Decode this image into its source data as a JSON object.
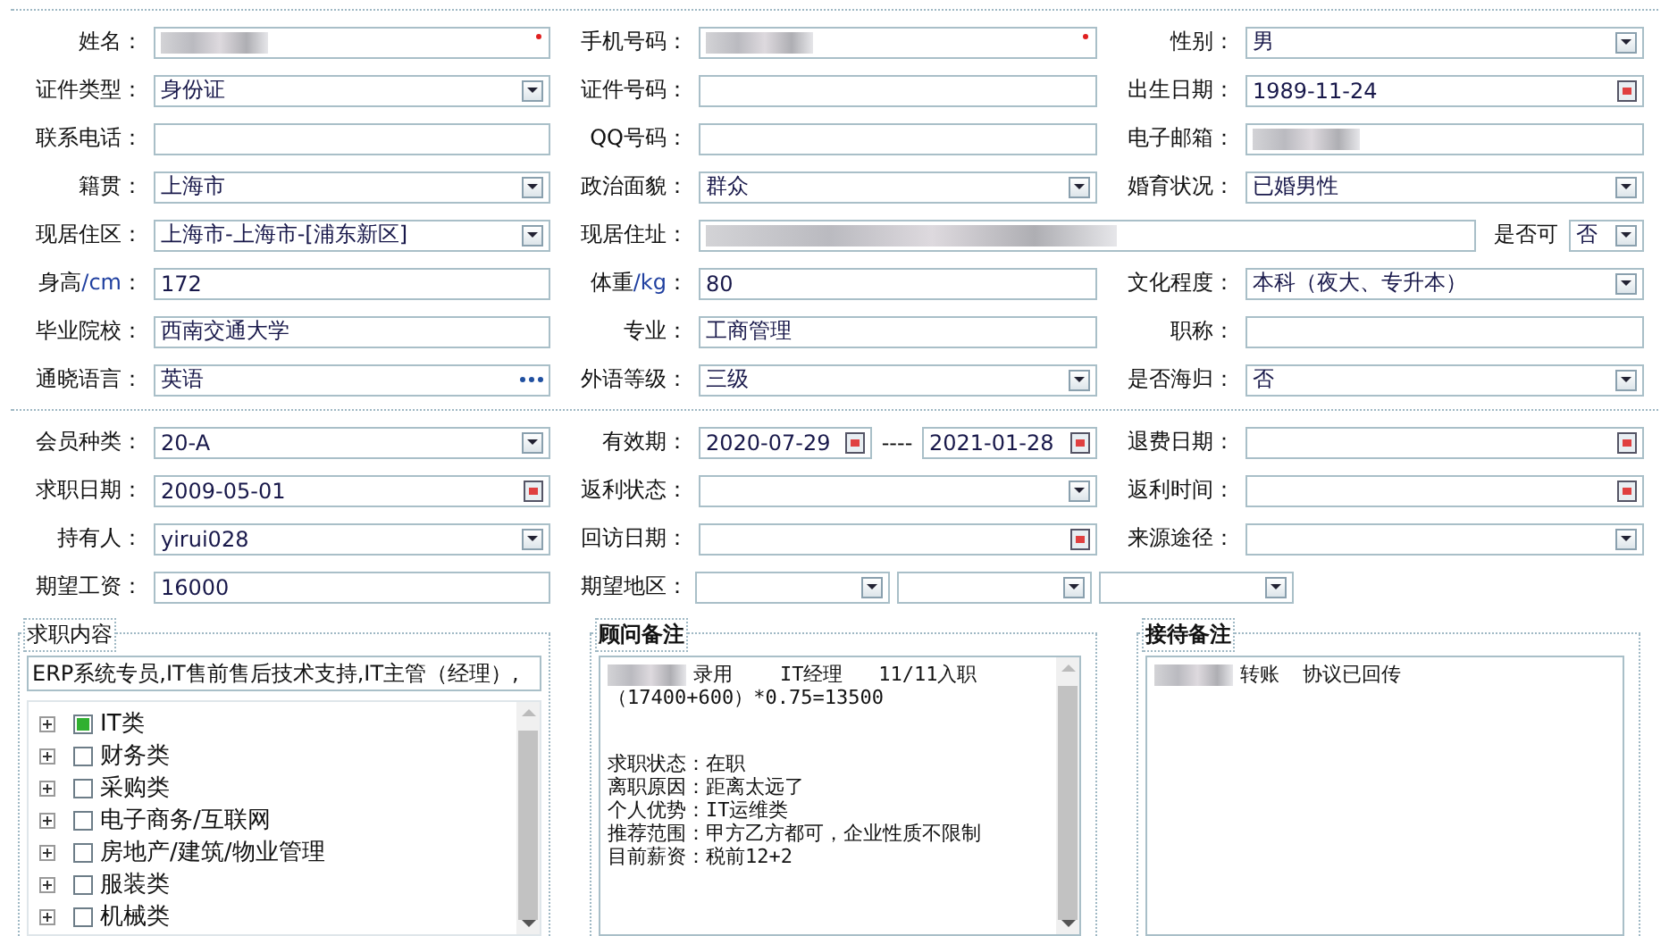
{
  "profile_rows": [
    [
      {
        "label": "姓名：",
        "field": {
          "kind": "text",
          "redacted": true,
          "required": true
        }
      },
      {
        "label": "手机号码：",
        "field": {
          "kind": "text",
          "redacted": true,
          "required": true
        }
      },
      {
        "label": "性别：",
        "field": {
          "kind": "select",
          "value": "男"
        }
      }
    ],
    [
      {
        "label": "证件类型：",
        "field": {
          "kind": "select",
          "value": "身份证"
        }
      },
      {
        "label": "证件号码：",
        "field": {
          "kind": "text"
        }
      },
      {
        "label": "出生日期：",
        "field": {
          "kind": "date",
          "value": "1989-11-24"
        }
      }
    ],
    [
      {
        "label": "联系电话：",
        "field": {
          "kind": "text"
        }
      },
      {
        "label": "QQ号码：",
        "field": {
          "kind": "text"
        }
      },
      {
        "label": "电子邮箱：",
        "field": {
          "kind": "text",
          "redacted": true
        }
      }
    ],
    [
      {
        "label": "籍贯：",
        "field": {
          "kind": "select",
          "value": "上海市"
        }
      },
      {
        "label": "政治面貌：",
        "field": {
          "kind": "select",
          "value": "群众"
        }
      },
      {
        "label": "婚育状况：",
        "field": {
          "kind": "select",
          "value": "已婚男性"
        }
      }
    ],
    [
      {
        "label": "现居住区：",
        "field": {
          "kind": "select",
          "value": "上海市-上海市-[浦东新区]"
        }
      },
      {
        "label": "现居住址：",
        "field": {
          "kind": "address",
          "redacted": true,
          "option_label": "是否可",
          "option_value": "否"
        }
      }
    ],
    [
      {
        "label": "身高",
        "unit": "/cm",
        "colon": "：",
        "field": {
          "kind": "text",
          "value": "172"
        }
      },
      {
        "label": "体重",
        "unit": "/kg",
        "colon": "：",
        "field": {
          "kind": "text",
          "value": "80"
        }
      },
      {
        "label": "文化程度：",
        "field": {
          "kind": "select",
          "value": "本科（夜大、专升本）"
        }
      }
    ],
    [
      {
        "label": "毕业院校：",
        "field": {
          "kind": "text",
          "value": "西南交通大学"
        }
      },
      {
        "label": "专业：",
        "field": {
          "kind": "text",
          "value": "工商管理"
        }
      },
      {
        "label": "职称：",
        "field": {
          "kind": "text"
        }
      }
    ],
    [
      {
        "label": "通晓语言：",
        "field": {
          "kind": "picker",
          "value": "英语"
        }
      },
      {
        "label": "外语等级：",
        "field": {
          "kind": "select",
          "value": "三级"
        }
      },
      {
        "label": "是否海归：",
        "field": {
          "kind": "select",
          "value": "否"
        }
      }
    ]
  ],
  "membership_rows": [
    [
      {
        "label": "会员种类：",
        "field": {
          "kind": "select",
          "value": "20-A"
        }
      },
      {
        "label": "有效期：",
        "field": {
          "kind": "date_range",
          "from": "2020-07-29",
          "separator": "----",
          "to": "2021-01-28"
        }
      },
      {
        "label": "退费日期：",
        "field": {
          "kind": "date"
        }
      }
    ],
    [
      {
        "label": "求职日期：",
        "field": {
          "kind": "date",
          "value": "2009-05-01"
        }
      },
      {
        "label": "返利状态：",
        "field": {
          "kind": "select"
        }
      },
      {
        "label": "返利时间：",
        "field": {
          "kind": "date"
        }
      }
    ],
    [
      {
        "label": "持有人：",
        "field": {
          "kind": "select",
          "value": "yirui028"
        }
      },
      {
        "label": "回访日期：",
        "field": {
          "kind": "date"
        }
      },
      {
        "label": "来源途径：",
        "field": {
          "kind": "select"
        }
      }
    ],
    [
      {
        "label": "期望工资：",
        "field": {
          "kind": "text",
          "value": "16000"
        }
      },
      {
        "label": "期望地区：",
        "field": {
          "kind": "multi_select",
          "selects": [
            {
              "kind": "select"
            },
            {
              "kind": "select"
            },
            {
              "kind": "select"
            }
          ]
        }
      }
    ]
  ],
  "job_panel": {
    "legend": "求职内容",
    "summary": "ERP系统专员,IT售前售后技术支持,IT主管（经理）,",
    "categories": [
      {
        "label": "IT类",
        "checked": true
      },
      {
        "label": "财务类",
        "checked": false
      },
      {
        "label": "采购类",
        "checked": false
      },
      {
        "label": "电子商务/互联网",
        "checked": false
      },
      {
        "label": "房地产/建筑/物业管理",
        "checked": false
      },
      {
        "label": "服装类",
        "checked": false
      },
      {
        "label": "机械类",
        "checked": false
      }
    ]
  },
  "advisor_panel": {
    "legend": "顾问备注",
    "paragraphs": [
      [
        {
          "text": "录用    IT经理   11/11入职",
          "redacted": true
        },
        {
          "text": "（17400+600）*0.75=13500",
          "redacted": false
        }
      ],
      [
        {
          "text": "求职状态：在职",
          "redacted": false
        },
        {
          "text": "离职原因：距离太远了",
          "redacted": false
        },
        {
          "text": "个人优势：IT运维类",
          "redacted": false
        },
        {
          "text": "推荐范围：甲方乙方都可，企业性质不限制",
          "redacted": false
        },
        {
          "text": "目前薪资：税前12+2",
          "redacted": false
        }
      ]
    ]
  },
  "reception_panel": {
    "legend": "接待备注",
    "paragraphs": [
      [
        {
          "text": "转账  协议已回传",
          "redacted": true
        }
      ]
    ]
  }
}
